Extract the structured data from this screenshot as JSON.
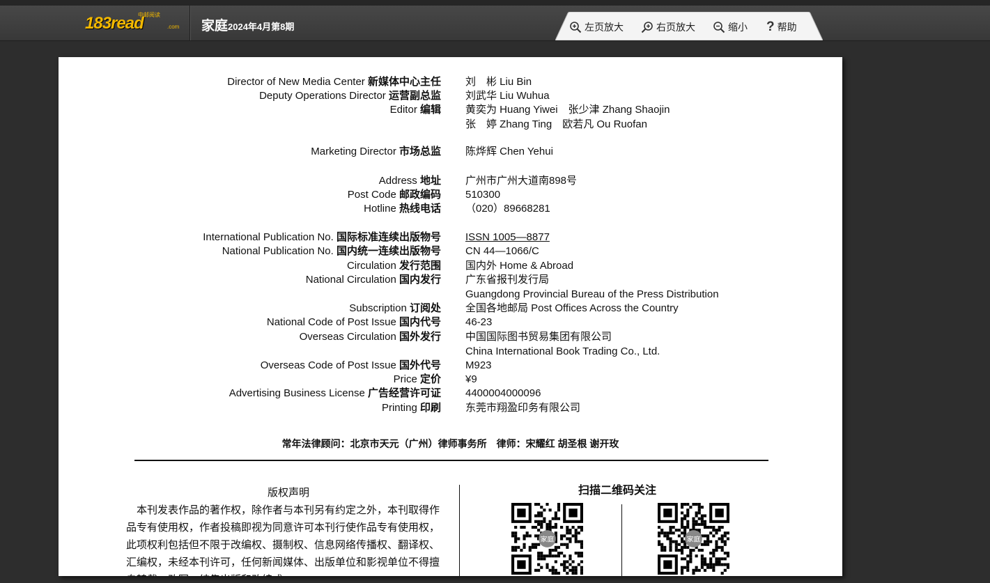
{
  "topbar": {
    "logo_main": "183read",
    "logo_small": "中邮阅读",
    "logo_com": ".com",
    "magazine_name": "家庭",
    "issue": "2024年4月第8期"
  },
  "toolbar": {
    "zoom_left": "左页放大",
    "zoom_right": "右页放大",
    "zoom_out": "缩小",
    "help": "帮助"
  },
  "page": {
    "masthead": [
      {
        "label_en": "Director of New Media Center ",
        "label_cn": "新媒体中心主任",
        "value": [
          "刘　彬 Liu Bin"
        ]
      },
      {
        "label_en": "Deputy Operations Director ",
        "label_cn": "运营副总监",
        "value": [
          "刘武华 Liu Wuhua"
        ]
      },
      {
        "label_en": "Editor ",
        "label_cn": "编辑",
        "value": [
          "黄奕为 Huang Yiwei　张少津 Zhang Shaojin",
          "张　婷 Zhang Ting　欧若凡 Ou Ruofan"
        ]
      },
      {
        "label_en": "Marketing Director ",
        "label_cn": "市场总监",
        "value": [
          "陈烨辉 Chen Yehui"
        ]
      },
      {
        "label_en": "Address ",
        "label_cn": "地址",
        "value": [
          "广州市广州大道南898号"
        ]
      },
      {
        "label_en": "Post Code ",
        "label_cn": "邮政编码",
        "value": [
          "510300"
        ]
      },
      {
        "label_en": "Hotline ",
        "label_cn": "热线电话",
        "value": [
          "（020）89668281"
        ]
      },
      {
        "label_en": "International Publication No. ",
        "label_cn": "国际标准连续出版物号",
        "value": [
          "ISSN 1005—8877"
        ]
      },
      {
        "label_en": "National Publication No. ",
        "label_cn": "国内统一连续出版物号",
        "value": [
          "CN 44—1066/C"
        ]
      },
      {
        "label_en": "Circulation ",
        "label_cn": "发行范围",
        "value": [
          "国内外 Home & Abroad"
        ]
      },
      {
        "label_en": "National Circulation ",
        "label_cn": "国内发行",
        "value": [
          "广东省报刊发行局",
          "Guangdong Provincial Bureau of the Press Distribution"
        ]
      },
      {
        "label_en": "Subscription ",
        "label_cn": "订阅处",
        "value": [
          "全国各地邮局  Post Offices Across the Country"
        ]
      },
      {
        "label_en": "National Code of Post Issue ",
        "label_cn": "国内代号",
        "value": [
          "46-23"
        ]
      },
      {
        "label_en": "Overseas Circulation ",
        "label_cn": "国外发行",
        "value": [
          "中国国际图书贸易集团有限公司",
          "China International Book Trading Co., Ltd."
        ]
      },
      {
        "label_en": "Overseas Code of Post Issue ",
        "label_cn": "国外代号",
        "value": [
          "M923"
        ]
      },
      {
        "label_en": "Price ",
        "label_cn": "定价",
        "value": [
          "¥9"
        ]
      },
      {
        "label_en": "Advertising Business License ",
        "label_cn": "广告经营许可证",
        "value": [
          "4400004000096"
        ]
      },
      {
        "label_en": "Printing ",
        "label_cn": "印刷",
        "value": [
          "东莞市翔盈印务有限公司"
        ]
      }
    ],
    "lawyer": "常年法律顾问：北京市天元（广州）律师事务所　律师：宋耀红  胡圣根  谢开玫",
    "copyright_title": "版权声明",
    "copyright_body": "　本刊发表作品的著作权，除作者与本刊另有约定之外，本刊取得作品专有使用权，作者投稿即视为同意许可本刊行使作品专有使用权，此项权利包括但不限于改编权、摄制权、信息网络传播权、翻译权、汇编权，未经本刊许可，任何新闻媒体、出版单位和影视单位不得擅自转载、改写、结集出版和改编成",
    "qr_title": "扫描二维码关注",
    "qr_center_label": "家庭"
  }
}
